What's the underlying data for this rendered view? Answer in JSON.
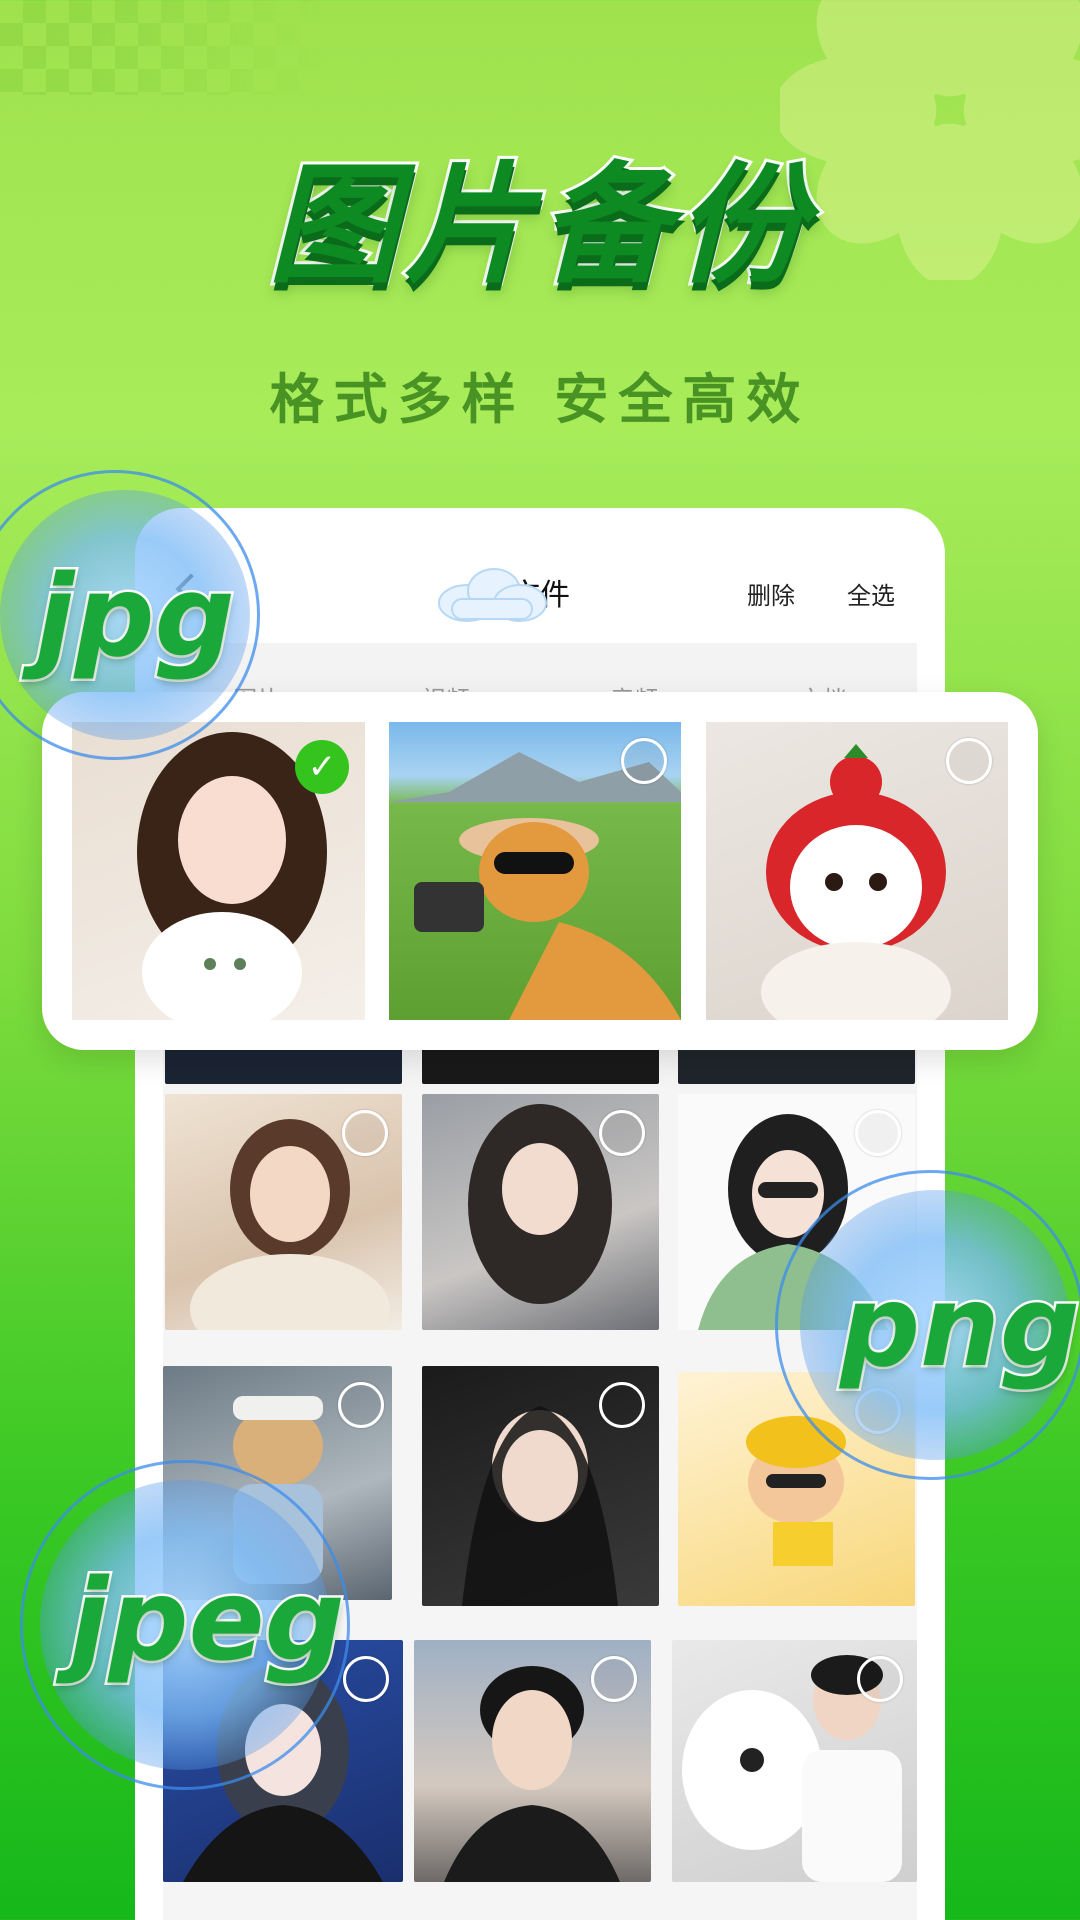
{
  "hero": {
    "title": "图片备份",
    "subtitle": "格式多样 安全高效"
  },
  "phone": {
    "header": {
      "title": "文件",
      "delete_label": "删除",
      "select_all_label": "全选"
    },
    "tabs": [
      "图片",
      "视频",
      "音频",
      "文档"
    ]
  },
  "card": {
    "items": [
      {
        "icon": "photo-girl-with-cat",
        "selected": true,
        "check_icon": "✓"
      },
      {
        "icon": "photo-cat-cowboy-selfie",
        "selected": false
      },
      {
        "icon": "photo-cat-strawberry-hat",
        "selected": false
      }
    ]
  },
  "grid": {
    "items": [
      {
        "icon": "photo-girl-sweater",
        "selected": false
      },
      {
        "icon": "photo-girl-car",
        "selected": false
      },
      {
        "icon": "photo-girl-sunglasses-illustration",
        "selected": false
      },
      {
        "icon": "photo-cat-outfit",
        "selected": false
      },
      {
        "icon": "photo-boy-hoodie",
        "selected": false
      },
      {
        "icon": "photo-cat-yellow-hat-reading",
        "selected": false
      },
      {
        "icon": "photo-girl-illustration",
        "selected": false
      },
      {
        "icon": "photo-boy-portrait",
        "selected": false
      },
      {
        "icon": "photo-boy-with-dog",
        "selected": false
      }
    ]
  },
  "badges": {
    "jpg": "jpg",
    "png": "png",
    "jpeg": "jpeg"
  },
  "colors": {
    "title_green": "#0e8a22",
    "badge_green": "#1aa83a",
    "check_green": "#35c41e",
    "bubble_blue": "#78b9f5"
  }
}
